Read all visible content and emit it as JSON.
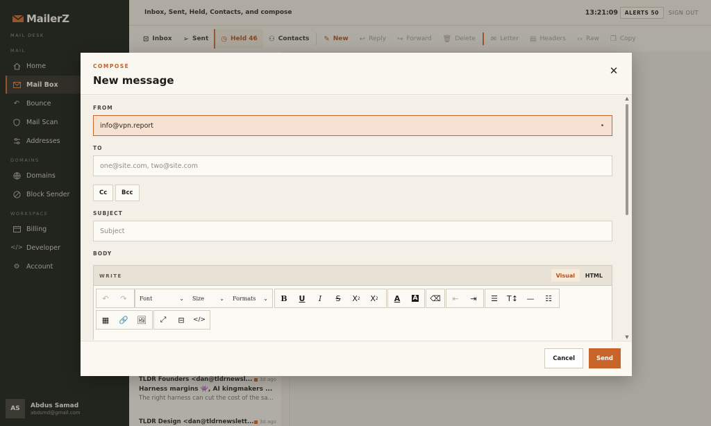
{
  "app": {
    "name": "MailerZ",
    "subtitle": "MAIL DESK"
  },
  "sidebar": {
    "sections": [
      {
        "label": "MAIL"
      },
      {
        "label": "DOMAINS"
      },
      {
        "label": "WORKSPACE"
      }
    ],
    "items": [
      {
        "label": "Home",
        "icon": "home-icon"
      },
      {
        "label": "Mail Box",
        "icon": "envelope-icon",
        "active": true
      },
      {
        "label": "Bounce",
        "icon": "bounce-icon"
      },
      {
        "label": "Mail Scan",
        "icon": "shield-icon"
      },
      {
        "label": "Addresses",
        "icon": "sliders-icon"
      },
      {
        "label": "Domains",
        "icon": "globe-icon"
      },
      {
        "label": "Block Sender",
        "icon": "block-icon"
      },
      {
        "label": "Billing",
        "icon": "card-icon"
      },
      {
        "label": "Developer",
        "icon": "code-icon"
      },
      {
        "label": "Account",
        "icon": "gear-icon"
      }
    ],
    "user": {
      "initials": "AS",
      "name": "Abdus Samad",
      "email": "abdsmd@gmail.com"
    }
  },
  "topbar": {
    "breadcrumb": "Inbox, Sent, Held, Contacts, and compose",
    "time": "13:21:09",
    "alerts": "ALERTS 50",
    "signout": "SIGN OUT"
  },
  "toolbar": {
    "inbox": "Inbox",
    "sent": "Sent",
    "held": "Held 46",
    "contacts": "Contacts",
    "new": "New",
    "reply": "Reply",
    "forward": "Forward",
    "delete": "Delete",
    "letter": "Letter",
    "headers": "Headers",
    "raw": "Raw",
    "copy": "Copy"
  },
  "list": [
    {
      "from": "TLDR Founders <dan@tldrnewsl...",
      "date": "3d ago",
      "subject": "Harness margins 👾, AI kingmakers ...",
      "preview": "The right harness can cut the cost of the sa..."
    },
    {
      "from": "TLDR Design <dan@tldrnewslett...",
      "date": "3d ago",
      "subject": "",
      "preview": ""
    }
  ],
  "compose": {
    "kicker": "COMPOSE",
    "title": "New message",
    "from_label": "FROM",
    "from_value": "info@vpn.report",
    "to_label": "TO",
    "to_placeholder": "one@site.com, two@site.com",
    "cc_label": "Cc",
    "bcc_label": "Bcc",
    "subject_label": "SUBJECT",
    "subject_placeholder": "Subject",
    "body_label": "BODY",
    "editor": {
      "write_label": "WRITE",
      "visual_tab": "Visual",
      "html_tab": "HTML",
      "font_select": "Font",
      "size_select": "Size",
      "formats_select": "Formats"
    },
    "cancel": "Cancel",
    "send": "Send"
  },
  "colors": {
    "accent": "#c8642a",
    "sidebar_bg": "#141a14"
  }
}
